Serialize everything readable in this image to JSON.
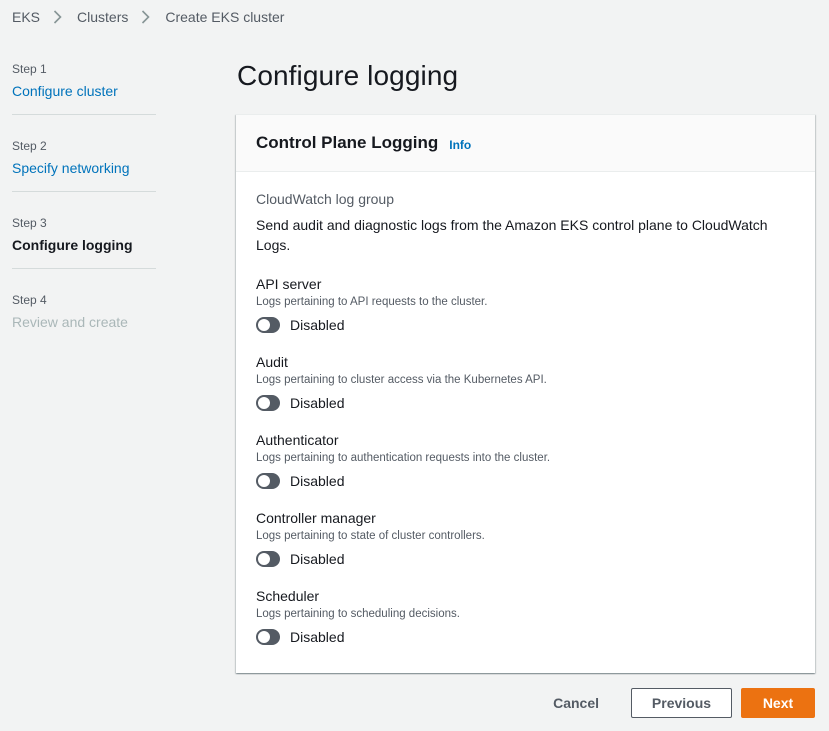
{
  "breadcrumb": {
    "items": [
      "EKS",
      "Clusters"
    ],
    "current": "Create EKS cluster"
  },
  "steps": [
    {
      "num": "Step 1",
      "title": "Configure cluster",
      "state": "link"
    },
    {
      "num": "Step 2",
      "title": "Specify networking",
      "state": "link"
    },
    {
      "num": "Step 3",
      "title": "Configure logging",
      "state": "active"
    },
    {
      "num": "Step 4",
      "title": "Review and create",
      "state": "disabled"
    }
  ],
  "page_title": "Configure logging",
  "panel": {
    "title": "Control Plane Logging",
    "info": "Info",
    "group_label": "CloudWatch log group",
    "group_desc": "Send audit and diagnostic logs from the Amazon EKS control plane to CloudWatch Logs.",
    "logs": [
      {
        "name": "API server",
        "desc": "Logs pertaining to API requests to the cluster.",
        "state": "Disabled"
      },
      {
        "name": "Audit",
        "desc": "Logs pertaining to cluster access via the Kubernetes API.",
        "state": "Disabled"
      },
      {
        "name": "Authenticator",
        "desc": "Logs pertaining to authentication requests into the cluster.",
        "state": "Disabled"
      },
      {
        "name": "Controller manager",
        "desc": "Logs pertaining to state of cluster controllers.",
        "state": "Disabled"
      },
      {
        "name": "Scheduler",
        "desc": "Logs pertaining to scheduling decisions.",
        "state": "Disabled"
      }
    ]
  },
  "footer": {
    "cancel": "Cancel",
    "previous": "Previous",
    "next": "Next"
  },
  "colors": {
    "accent": "#ec7211",
    "link": "#0073bb",
    "toggle_off": "#545b64"
  }
}
